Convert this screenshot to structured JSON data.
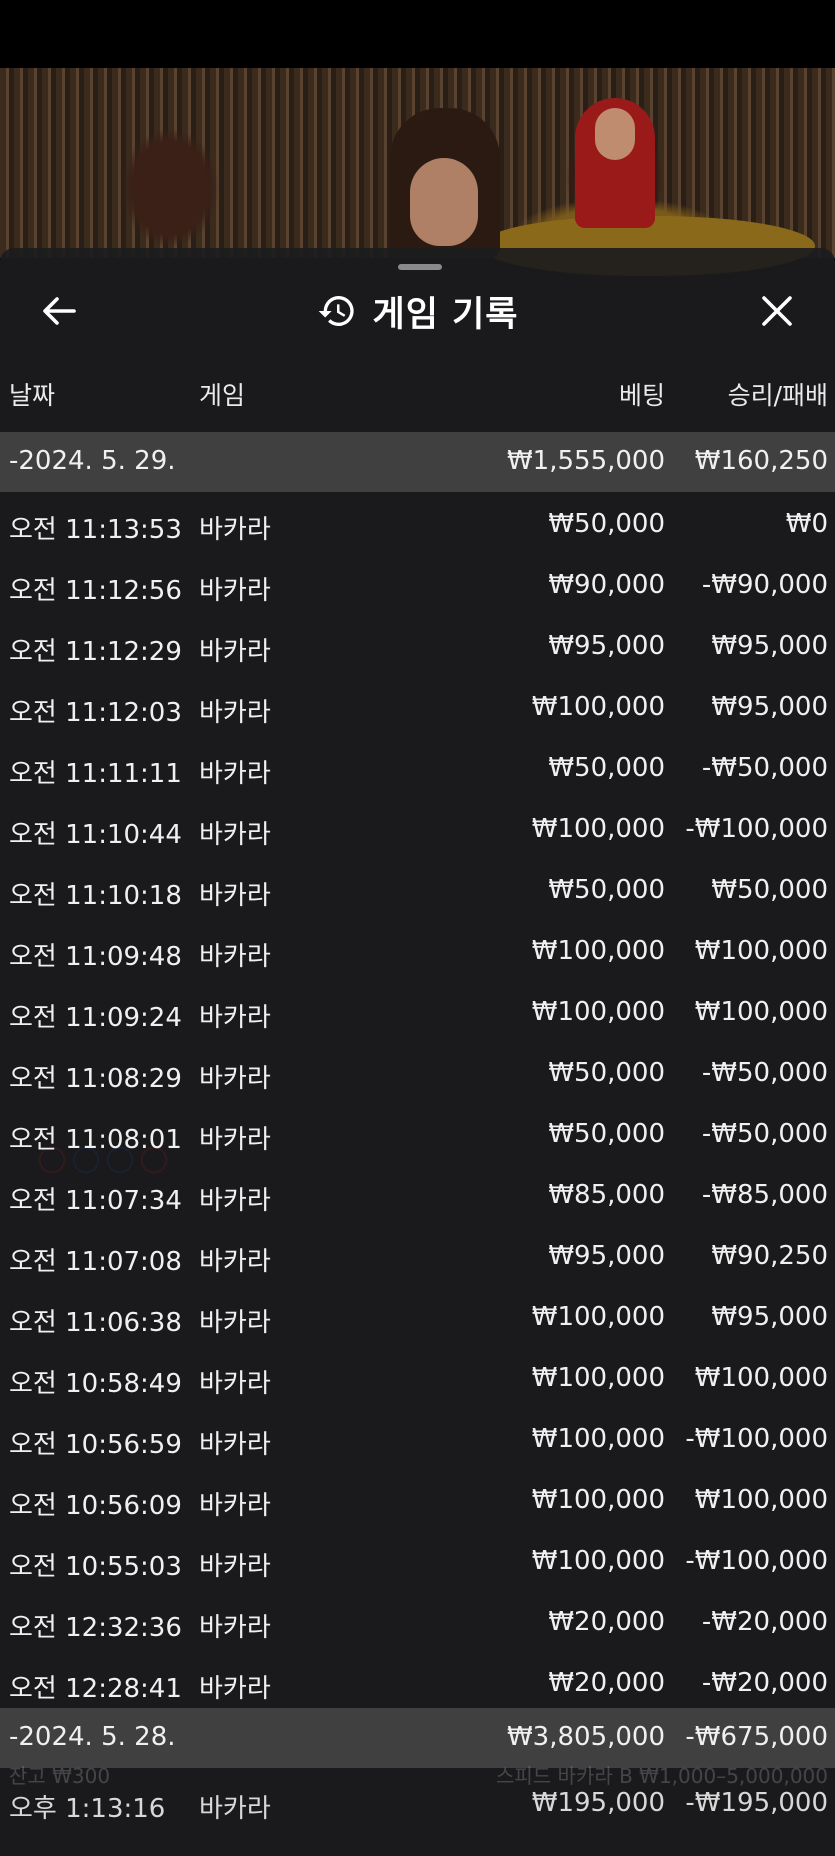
{
  "header": {
    "title": "게임 기록"
  },
  "columns": {
    "date": "날짜",
    "game": "게임",
    "bet": "베팅",
    "winloss": "승리/패배"
  },
  "groups": [
    {
      "date": "-2024. 5. 29.",
      "bet": "₩1,555,000",
      "winloss": "₩160,250",
      "rows": [
        {
          "time": "오전 11:13:53",
          "game": "바카라",
          "bet": "₩50,000",
          "winloss": "₩0"
        },
        {
          "time": "오전 11:12:56",
          "game": "바카라",
          "bet": "₩90,000",
          "winloss": "-₩90,000"
        },
        {
          "time": "오전 11:12:29",
          "game": "바카라",
          "bet": "₩95,000",
          "winloss": "₩95,000"
        },
        {
          "time": "오전 11:12:03",
          "game": "바카라",
          "bet": "₩100,000",
          "winloss": "₩95,000"
        },
        {
          "time": "오전 11:11:11",
          "game": "바카라",
          "bet": "₩50,000",
          "winloss": "-₩50,000"
        },
        {
          "time": "오전 11:10:44",
          "game": "바카라",
          "bet": "₩100,000",
          "winloss": "-₩100,000"
        },
        {
          "time": "오전 11:10:18",
          "game": "바카라",
          "bet": "₩50,000",
          "winloss": "₩50,000"
        },
        {
          "time": "오전 11:09:48",
          "game": "바카라",
          "bet": "₩100,000",
          "winloss": "₩100,000"
        },
        {
          "time": "오전 11:09:24",
          "game": "바카라",
          "bet": "₩100,000",
          "winloss": "₩100,000"
        },
        {
          "time": "오전 11:08:29",
          "game": "바카라",
          "bet": "₩50,000",
          "winloss": "-₩50,000"
        },
        {
          "time": "오전 11:08:01",
          "game": "바카라",
          "bet": "₩50,000",
          "winloss": "-₩50,000"
        },
        {
          "time": "오전 11:07:34",
          "game": "바카라",
          "bet": "₩85,000",
          "winloss": "-₩85,000"
        },
        {
          "time": "오전 11:07:08",
          "game": "바카라",
          "bet": "₩95,000",
          "winloss": "₩90,250"
        },
        {
          "time": "오전 11:06:38",
          "game": "바카라",
          "bet": "₩100,000",
          "winloss": "₩95,000"
        },
        {
          "time": "오전 10:58:49",
          "game": "바카라",
          "bet": "₩100,000",
          "winloss": "₩100,000"
        },
        {
          "time": "오전 10:56:59",
          "game": "바카라",
          "bet": "₩100,000",
          "winloss": "-₩100,000"
        },
        {
          "time": "오전 10:56:09",
          "game": "바카라",
          "bet": "₩100,000",
          "winloss": "₩100,000"
        },
        {
          "time": "오전 10:55:03",
          "game": "바카라",
          "bet": "₩100,000",
          "winloss": "-₩100,000"
        },
        {
          "time": "오전 12:32:36",
          "game": "바카라",
          "bet": "₩20,000",
          "winloss": "-₩20,000"
        },
        {
          "time": "오전 12:28:41",
          "game": "바카라",
          "bet": "₩20,000",
          "winloss": "-₩20,000"
        }
      ]
    },
    {
      "date": "-2024. 5. 28.",
      "bet": "₩3,805,000",
      "winloss": "-₩675,000",
      "rows": [
        {
          "time": "오후 1:13:16",
          "game": "바카라",
          "bet": "₩195,000",
          "winloss": "-₩195,000"
        }
      ]
    }
  ],
  "background_overlay": {
    "balance": "잔고 ₩300",
    "table_info": "스피드 바카라 B ₩1,000–5,000,000"
  },
  "icons": {
    "back": "back-arrow-icon",
    "history": "history-icon",
    "close": "close-icon"
  }
}
